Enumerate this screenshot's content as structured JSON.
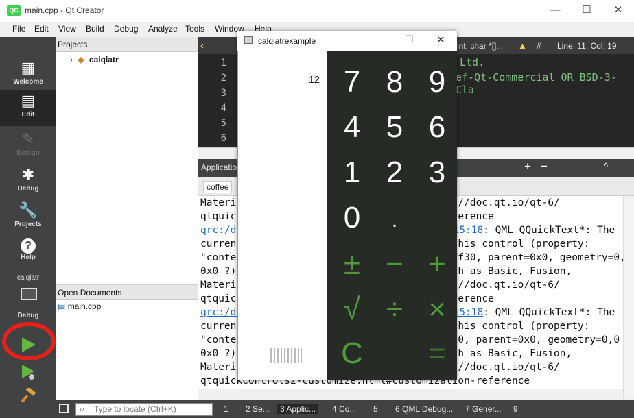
{
  "window": {
    "title": "main.cpp - Qt Creator",
    "logo": "QC",
    "minimize": "—",
    "maximize": "☐",
    "close": "✕"
  },
  "menu": [
    "File",
    "Edit",
    "View",
    "Build",
    "Debug",
    "Analyze",
    "Tools",
    "Window",
    "Help"
  ],
  "modes": [
    {
      "label": "Welcome",
      "icon": "▦"
    },
    {
      "label": "Edit",
      "icon": "▤"
    },
    {
      "label": "Design",
      "icon": "✎"
    },
    {
      "label": "Debug",
      "icon": "✱"
    },
    {
      "label": "Projects",
      "icon": "🔧"
    },
    {
      "label": "Help",
      "icon": "?"
    }
  ],
  "kit": {
    "project": "calqlatr",
    "label": "Debug"
  },
  "projects_panel": {
    "title": "Projects",
    "root": "calqlatr"
  },
  "open_docs_panel": {
    "title": "Open Documents",
    "file": "main.cpp"
  },
  "editor": {
    "symbol": "int, char *[]...",
    "position": "Line: 11, Col: 19",
    "line_numbers": [
      "1",
      "2",
      "3",
      "4",
      "5",
      "6"
    ],
    "code_lines": [
      "Ltd.",
      "ef-Qt-Commercial OR BSD-3-Cla"
    ]
  },
  "output_pane": {
    "title": "Applicatio",
    "tab": "coffee",
    "lines": [
      "Materia                                  s://doc.qt.io/qt-6/",
      "qtquick                                  eference",
      "                                        : QML QQuickText*: The",
      "current                                   this control (property:",
      "\"conten                                   ff30, parent=0x0, geometry=0,0",
      "0x0 ?))                                  uch as Basic, Fusion,",
      "Materia                                  s://doc.qt.io/qt-6/",
      "qtquick                                  eference",
      "                                        : QML QQuickText*: The",
      "current                                   this control (property:",
      "\"conten                                  520, parent=0x0, geometry=0,0",
      "0x0 ?))                                  uch as Basic, Fusion,",
      "Materia                                  s://doc.qt.io/qt-6/",
      "qtquickcontrols2-customize.html#customization-reference"
    ],
    "link1a": "qrc:/de",
    "link1b": "l:15:18",
    "link2a": "qrc:/de",
    "link2b": "l:15:18"
  },
  "status": {
    "locator_placeholder": "Type to locate (Ctrl+K)",
    "tabs": [
      "1",
      "2  Se...",
      "3  Applic...",
      "4  Co...",
      "5",
      "6  QML Debug...",
      "7  Gener...",
      "9"
    ]
  },
  "calculator": {
    "title": "calqlatrexample",
    "display": "12",
    "digits": [
      "7",
      "8",
      "9",
      "4",
      "5",
      "6",
      "1",
      "2",
      "3",
      "0",
      "."
    ],
    "ops": [
      "±",
      "−",
      "+",
      "√",
      "÷",
      "×",
      "C",
      "="
    ]
  },
  "colors": {
    "accent_green": "#4f9a3b",
    "annotation_red": "#e8201a"
  }
}
